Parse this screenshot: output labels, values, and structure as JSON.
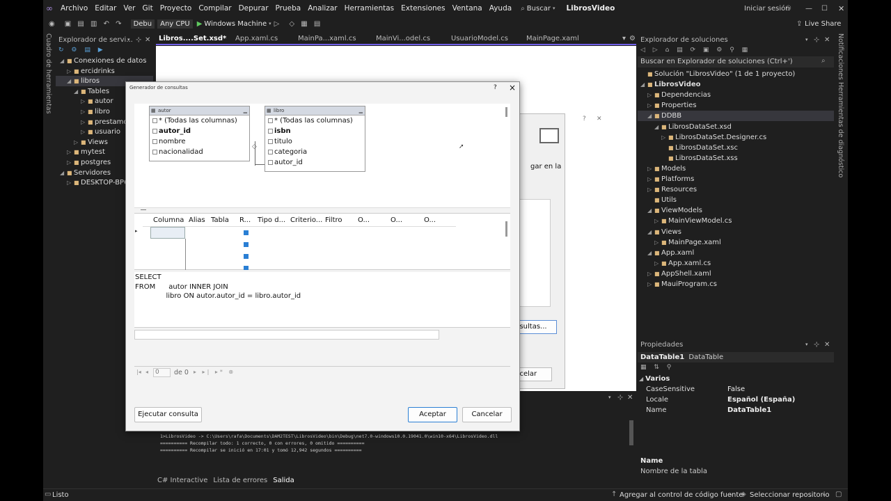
{
  "menu": {
    "items": [
      "Archivo",
      "Editar",
      "Ver",
      "Git",
      "Proyecto",
      "Compilar",
      "Depurar",
      "Prueba",
      "Analizar",
      "Herramientas",
      "Extensiones",
      "Ventana",
      "Ayuda"
    ],
    "search": "Buscar",
    "app_title": "LibrosVideo",
    "signin": "Iniciar sesión",
    "live_share": "Live Share"
  },
  "toolbar": {
    "config": "Debu",
    "platform": "Any CPU",
    "run_target": "Windows Machine"
  },
  "server_explorer": {
    "title": "Explorador de servi...",
    "items": [
      {
        "label": "Conexiones de datos",
        "indent": 0,
        "arrow": "◢"
      },
      {
        "label": "ercidrinks",
        "indent": 1,
        "arrow": "▷"
      },
      {
        "label": "libros",
        "indent": 1,
        "arrow": "◢",
        "selected": true
      },
      {
        "label": "Tables",
        "indent": 2,
        "arrow": "◢"
      },
      {
        "label": "autor",
        "indent": 3,
        "arrow": "▷"
      },
      {
        "label": "libro",
        "indent": 3,
        "arrow": "▷"
      },
      {
        "label": "prestamo",
        "indent": 3,
        "arrow": "▷"
      },
      {
        "label": "usuario",
        "indent": 3,
        "arrow": "▷"
      },
      {
        "label": "Views",
        "indent": 2,
        "arrow": "▷"
      },
      {
        "label": "mytest",
        "indent": 1,
        "arrow": "▷"
      },
      {
        "label": "postgres",
        "indent": 1,
        "arrow": "▷"
      },
      {
        "label": "Servidores",
        "indent": 0,
        "arrow": "◢"
      },
      {
        "label": "DESKTOP-BP6",
        "indent": 1,
        "arrow": "▷"
      }
    ]
  },
  "vertical": {
    "left": "Cuadro de herramientas",
    "right1": "Notificaciones",
    "right2": "Herramientas de diagnóstico"
  },
  "tabs": [
    "Libros....Set.xsd*",
    "App.xaml.cs",
    "MainPa...xaml.cs",
    "MainVi...odel.cs",
    "UsuarioModel.cs",
    "MainPage.xaml"
  ],
  "solution_explorer": {
    "title": "Explorador de soluciones",
    "search": "Buscar en Explorador de soluciones (Ctrl+')",
    "items": [
      {
        "label": "Solución \"LibrosVideo\"  (1 de 1 proyecto)",
        "indent": 0,
        "arrow": ""
      },
      {
        "label": "LibrosVideo",
        "indent": 0,
        "arrow": "◢",
        "bold": true
      },
      {
        "label": "Dependencias",
        "indent": 1,
        "arrow": "▷"
      },
      {
        "label": "Properties",
        "indent": 1,
        "arrow": "▷"
      },
      {
        "label": "DDBB",
        "indent": 1,
        "arrow": "◢",
        "selected": true
      },
      {
        "label": "LibrosDataSet.xsd",
        "indent": 2,
        "arrow": "◢"
      },
      {
        "label": "LibrosDataSet.Designer.cs",
        "indent": 3,
        "arrow": "▷"
      },
      {
        "label": "LibrosDataSet.xsc",
        "indent": 3,
        "arrow": ""
      },
      {
        "label": "LibrosDataSet.xss",
        "indent": 3,
        "arrow": ""
      },
      {
        "label": "Models",
        "indent": 1,
        "arrow": "▷"
      },
      {
        "label": "Platforms",
        "indent": 1,
        "arrow": "▷"
      },
      {
        "label": "Resources",
        "indent": 1,
        "arrow": "▷"
      },
      {
        "label": "Utils",
        "indent": 1,
        "arrow": ""
      },
      {
        "label": "ViewModels",
        "indent": 1,
        "arrow": "◢"
      },
      {
        "label": "MainViewModel.cs",
        "indent": 2,
        "arrow": "▷"
      },
      {
        "label": "Views",
        "indent": 1,
        "arrow": "◢"
      },
      {
        "label": "MainPage.xaml",
        "indent": 2,
        "arrow": "▷"
      },
      {
        "label": "App.xaml",
        "indent": 1,
        "arrow": "◢"
      },
      {
        "label": "App.xaml.cs",
        "indent": 2,
        "arrow": "▷"
      },
      {
        "label": "AppShell.xaml",
        "indent": 1,
        "arrow": "▷"
      },
      {
        "label": "MauiProgram.cs",
        "indent": 1,
        "arrow": "▷"
      }
    ]
  },
  "properties": {
    "title": "Propiedades",
    "object": "DataTable1",
    "object_type": "DataTable",
    "category": "Varios",
    "rows": [
      {
        "name": "CaseSensitive",
        "value": "False"
      },
      {
        "name": "Locale",
        "value": "Español (España)"
      },
      {
        "name": "Name",
        "value": "DataTable1"
      }
    ],
    "desc_title": "Name",
    "desc_text": "Nombre de la tabla"
  },
  "output": {
    "lines": [
      "1>LibrosVideo -> C:\\Users\\rafa\\Documents\\DAM2TEST\\LibrosVideo\\bin\\Debug\\net7.0-windows10.0.19041.0\\win10-x64\\LibrosVideo.dll",
      "========== Recompilar todo: 1 correcto, 0 con errores, 0 omitido ==========",
      "========== Recompilar se inició en 17:01 y tomó 12,942 segundos =========="
    ],
    "tabs": [
      "C# Interactive",
      "Lista de errores",
      "Salida"
    ]
  },
  "status": {
    "ready": "Listo",
    "source_control": "Agregar al control de código fuente",
    "repo": "Seleccionar repositorio"
  },
  "bg_dialog": {
    "text1": "gar en la",
    "btn1": "onsultas...",
    "btn2": "ancelar"
  },
  "dialog": {
    "title": "Generador de consultas",
    "help": "?",
    "close": "×",
    "tables": [
      {
        "name": "autor",
        "rows": [
          "* (Todas las columnas)",
          "autor_id",
          "nombre",
          "nacionalidad"
        ],
        "bold_index": 1
      },
      {
        "name": "libro",
        "rows": [
          "* (Todas las columnas)",
          "isbn",
          "titulo",
          "categoria",
          "autor_id"
        ],
        "bold_index": 1
      }
    ],
    "grid_headers": [
      "Columna",
      "Alias",
      "Tabla",
      "R...",
      "Tipo d...",
      "Criterio...",
      "Filtro",
      "O...",
      "O...",
      "O..."
    ],
    "sql": [
      "SELECT",
      "FROM      autor INNER JOIN",
      "              libro ON autor.autor_id = libro.autor_id"
    ],
    "nav": {
      "page": "0",
      "of": "de 0"
    },
    "buttons": {
      "execute": "Ejecutar consulta",
      "accept": "Aceptar",
      "cancel": "Cancelar"
    }
  }
}
